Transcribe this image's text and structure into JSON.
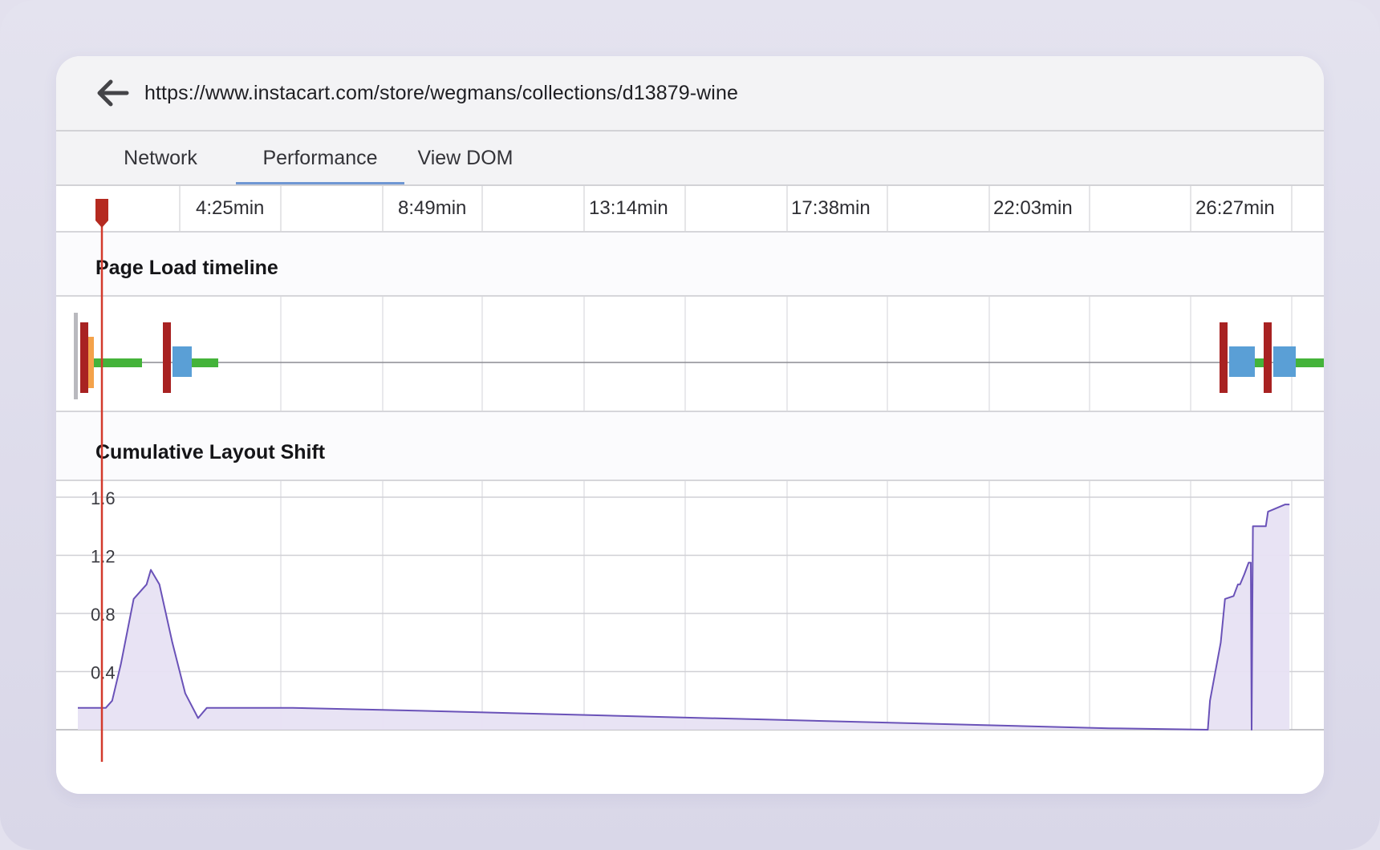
{
  "browser": {
    "url": "https://www.instacart.com/store/wegmans/collections/d13879-wine",
    "back_icon": "arrow-left-icon"
  },
  "tabs": [
    {
      "label": "Network",
      "active": false
    },
    {
      "label": "Performance",
      "active": true
    },
    {
      "label": "View DOM",
      "active": false
    }
  ],
  "ruler": {
    "ticks": [
      "4:25min",
      "8:49min",
      "13:14min",
      "17:38min",
      "22:03min",
      "26:27min"
    ]
  },
  "page_load": {
    "title": "Page Load timeline"
  },
  "cls": {
    "title": "Cumulative Layout Shift"
  },
  "colors": {
    "playhead": "#d33a2c",
    "marker_dark_red": "#a82222",
    "marker_orange": "#f4a24a",
    "network_green": "#44b33a",
    "blue_block": "#5a9fd6",
    "cls_line": "#6a52b8",
    "cls_fill": "#e7e1f3"
  },
  "chart_data": {
    "type": "area",
    "title": "Cumulative Layout Shift",
    "xlabel": "",
    "ylabel": "",
    "xlim": [
      0,
      29
    ],
    "ylim": [
      0,
      1.6
    ],
    "y_ticks": [
      "0.4",
      "0.8",
      "1.2",
      "1.6"
    ],
    "x_tick_labels": [
      "4:25min",
      "8:49min",
      "13:14min",
      "17:38min",
      "22:03min",
      "26:27min"
    ],
    "grid": true,
    "series": [
      {
        "x": [
          0.0,
          0.5,
          0.65,
          0.8,
          1.0,
          1.3,
          1.6,
          1.7,
          1.9,
          2.2,
          2.5,
          2.8,
          3.0,
          3.2,
          5.0,
          8.0,
          12.0,
          16.0,
          20.0,
          24.0,
          26.3,
          26.35,
          26.6,
          26.7,
          26.9,
          27.0,
          27.05,
          27.15,
          27.25,
          27.3,
          27.32,
          27.35,
          27.65,
          27.7,
          28.1,
          28.2
        ],
        "y": [
          0.15,
          0.15,
          0.15,
          0.2,
          0.45,
          0.9,
          1.0,
          1.1,
          1.0,
          0.6,
          0.25,
          0.08,
          0.15,
          0.15,
          0.15,
          0.13,
          0.1,
          0.07,
          0.04,
          0.01,
          0.0,
          0.2,
          0.6,
          0.9,
          0.92,
          1.0,
          1.0,
          1.07,
          1.15,
          1.15,
          0.0,
          1.4,
          1.4,
          1.5,
          1.55,
          1.55
        ]
      }
    ]
  }
}
